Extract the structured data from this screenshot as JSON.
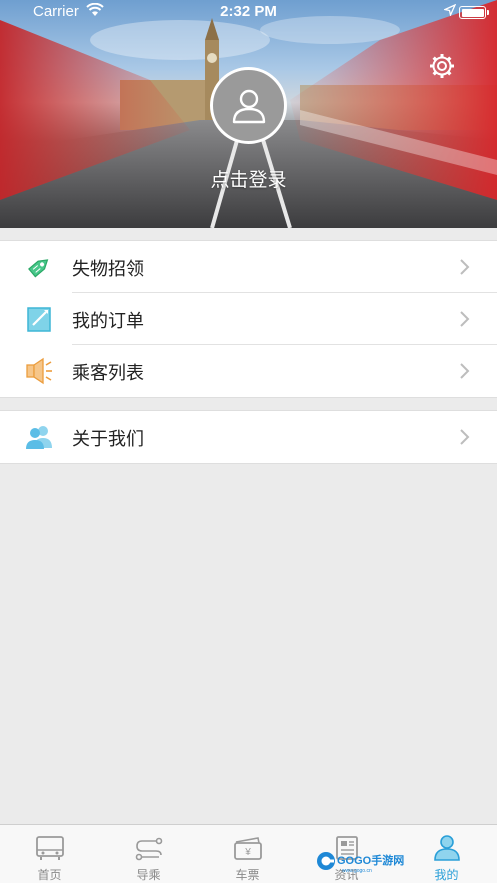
{
  "status_bar": {
    "carrier": "Carrier",
    "time": "2:32 PM"
  },
  "header": {
    "login_text": "点击登录"
  },
  "menu": {
    "group1": [
      {
        "label": "失物招领",
        "icon": "tag-icon"
      },
      {
        "label": "我的订单",
        "icon": "order-icon"
      },
      {
        "label": "乘客列表",
        "icon": "speaker-icon"
      }
    ],
    "group2": [
      {
        "label": "关于我们",
        "icon": "people-icon"
      }
    ]
  },
  "tabbar": {
    "tabs": [
      {
        "label": "首页",
        "icon": "bus-icon"
      },
      {
        "label": "导乘",
        "icon": "route-icon"
      },
      {
        "label": "车票",
        "icon": "ticket-icon"
      },
      {
        "label": "资讯",
        "icon": "news-icon"
      },
      {
        "label": "我的",
        "icon": "person-icon",
        "active": true
      }
    ]
  },
  "watermark": {
    "text": "GOGO手游网",
    "sub": "www.gogo.cn"
  },
  "colors": {
    "accent": "#2a9fd8",
    "background": "#ebebeb"
  }
}
